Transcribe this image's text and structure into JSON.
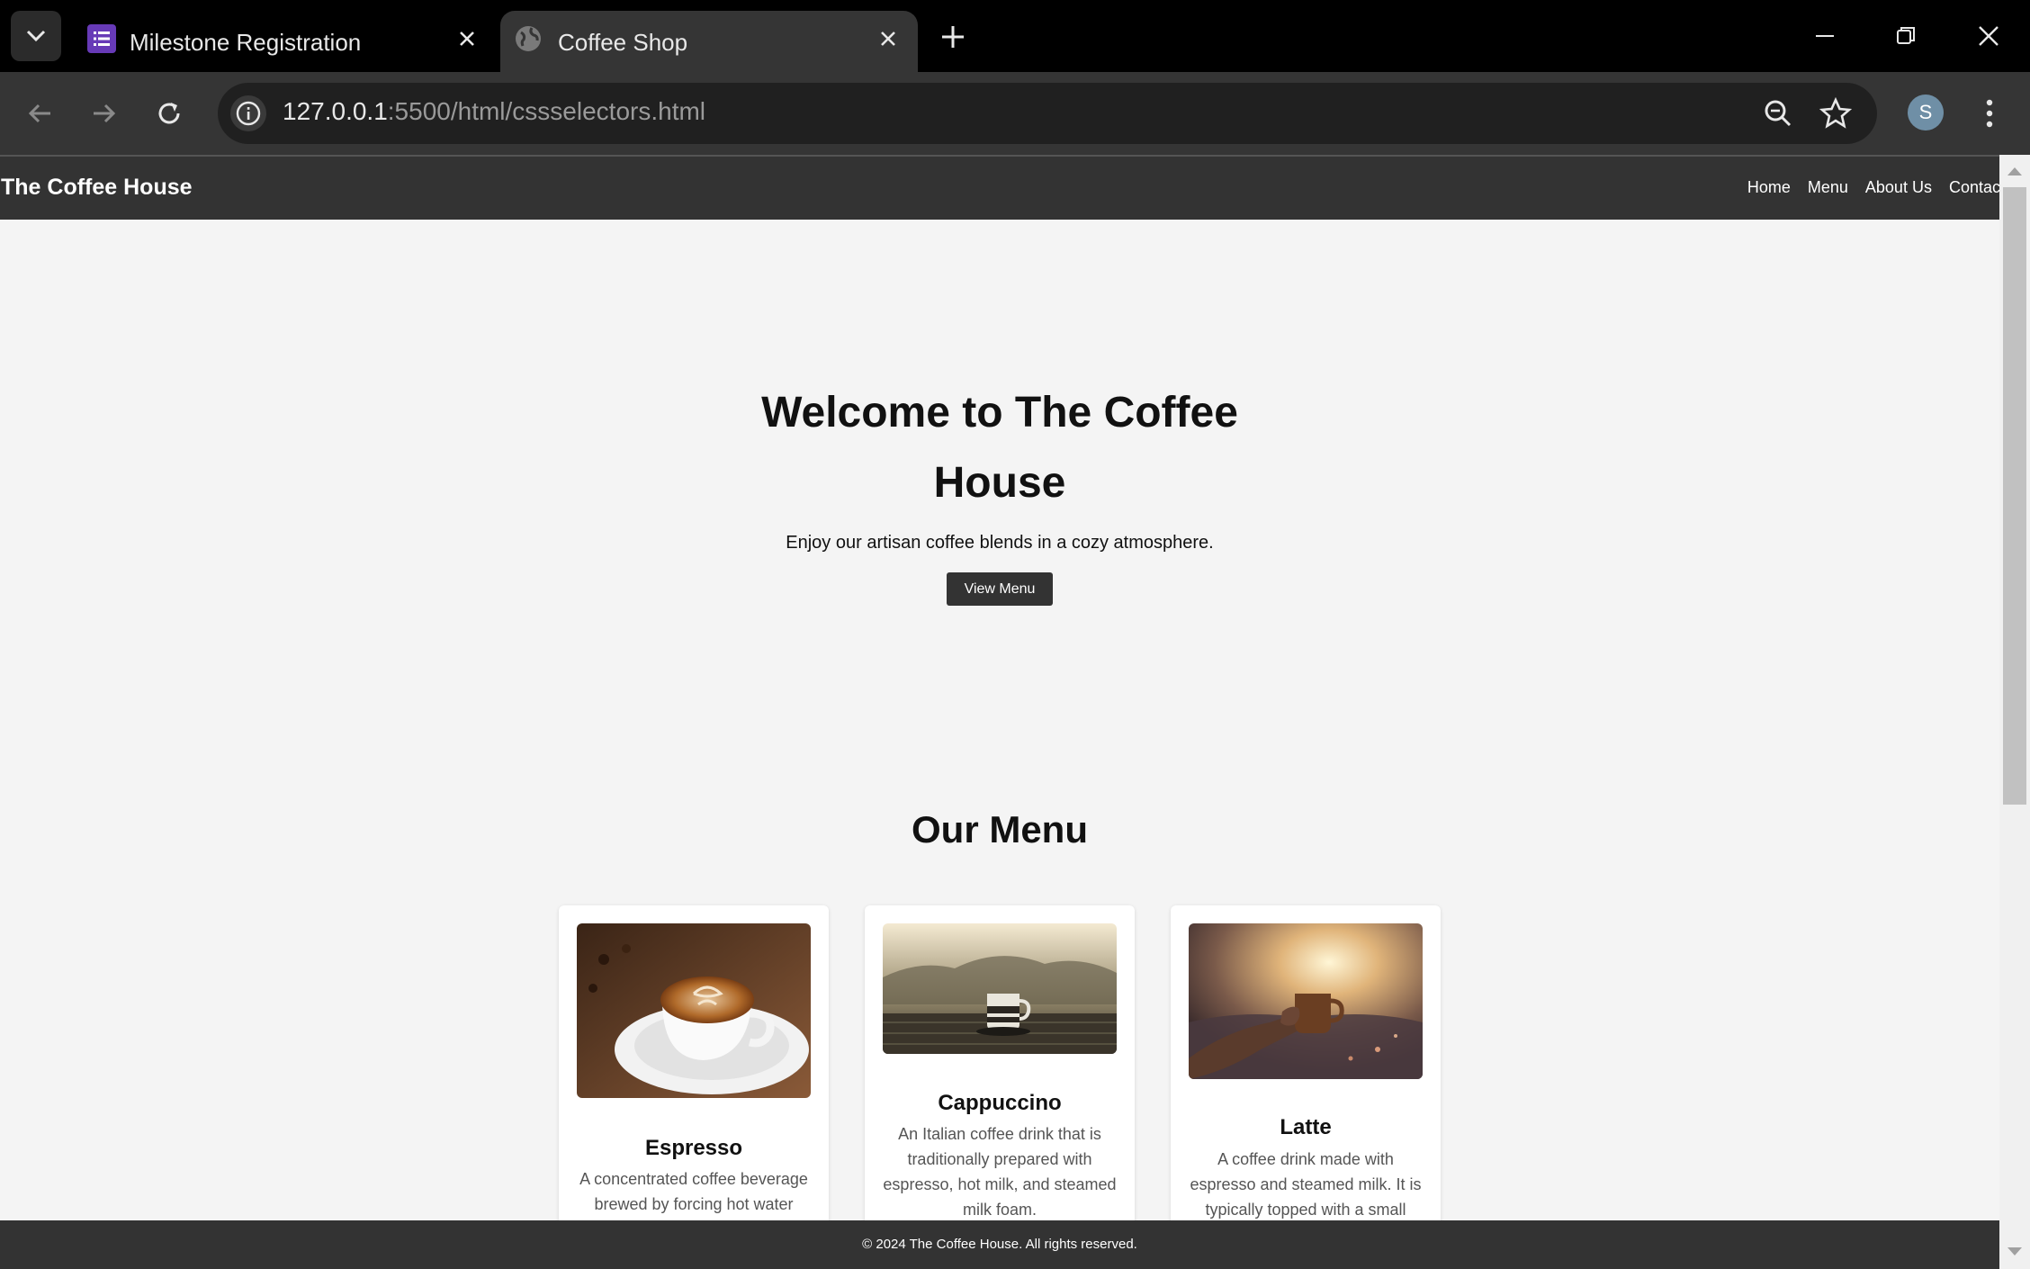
{
  "browser": {
    "tabs": [
      {
        "title": "Milestone Registration",
        "active": false,
        "icon": "forms-icon"
      },
      {
        "title": "Coffee Shop",
        "active": true,
        "icon": "globe-icon"
      }
    ],
    "url_host": "127.0.0.1",
    "url_path": ":5500/html/cssselectors.html",
    "profile_initial": "S"
  },
  "site": {
    "logo": "The Coffee House",
    "nav": [
      "Home",
      "Menu",
      "About Us",
      "Contact"
    ],
    "hero": {
      "title": "Welcome to The Coffee House",
      "subtitle": "Enjoy our artisan coffee blends in a cozy atmosphere.",
      "button": "View Menu"
    },
    "menu_title": "Our Menu",
    "items": [
      {
        "name": "Espresso",
        "description": "A concentrated coffee beverage brewed by forcing hot water"
      },
      {
        "name": "Cappuccino",
        "description": "An Italian coffee drink that is traditionally prepared with espresso, hot milk, and steamed milk foam."
      },
      {
        "name": "Latte",
        "description": "A coffee drink made with espresso and steamed milk. It is typically topped with a small"
      }
    ],
    "footer": "© 2024 The Coffee House. All rights reserved."
  },
  "colors": {
    "header_bg": "#333333",
    "page_bg": "#f4f4f4",
    "chrome_bg": "#353535"
  }
}
